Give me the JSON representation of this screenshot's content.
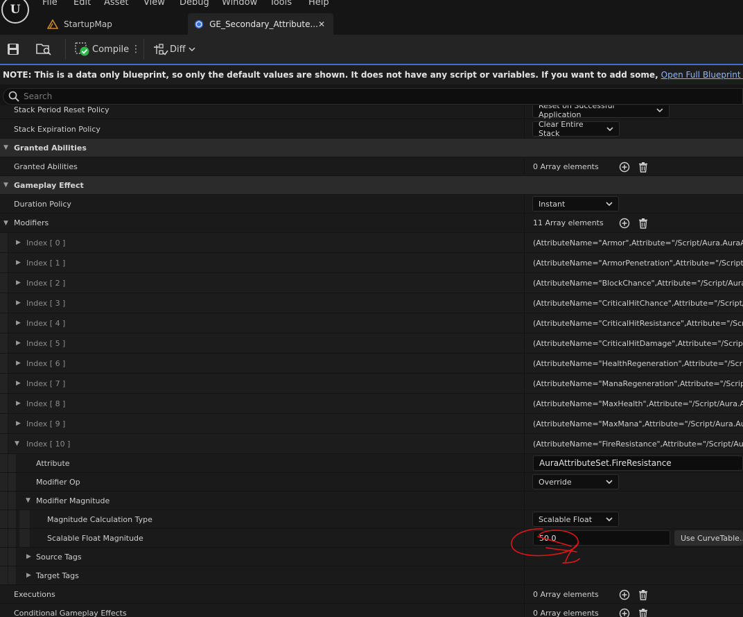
{
  "menu": [
    "File",
    "Edit",
    "Asset",
    "View",
    "Debug",
    "Window",
    "Tools",
    "Help"
  ],
  "tabs": [
    {
      "label": "StartupMap",
      "icon": "level-icon"
    },
    {
      "label": "GE_Secondary_Attribute...",
      "icon": "blueprint-icon"
    }
  ],
  "tab_close": "✕",
  "toolbar": {
    "compile_label": "Compile",
    "diff_label": "Diff"
  },
  "note": {
    "text": "NOTE: This is a data only blueprint, so only the default values are shown.  It does not have any script or variables.  If you want to add some,",
    "link": "Open Full Blueprint Editor"
  },
  "search": {
    "placeholder": "Search"
  },
  "details": {
    "stack_period_reset": {
      "label": "Stack Period Reset Policy",
      "value": "Reset on Successful Application"
    },
    "stack_expiration": {
      "label": "Stack Expiration Policy",
      "value": "Clear Entire Stack"
    },
    "cat_granted": "Granted Abilities",
    "granted_abilities": {
      "label": "Granted Abilities",
      "value": "0 Array elements"
    },
    "cat_gameplay_effect": "Gameplay Effect",
    "duration_policy": {
      "label": "Duration Policy",
      "value": "Instant"
    },
    "modifiers": {
      "label": "Modifiers",
      "value": "11 Array elements"
    },
    "indices": [
      {
        "label": "Index [ 0 ]",
        "value": "(AttributeName=\"Armor\",Attribute=\"/Script/Aura.AuraAttribu"
      },
      {
        "label": "Index [ 1 ]",
        "value": "(AttributeName=\"ArmorPenetration\",Attribute=\"/Script/Aura."
      },
      {
        "label": "Index [ 2 ]",
        "value": "(AttributeName=\"BlockChance\",Attribute=\"/Script/Aura.Aura"
      },
      {
        "label": "Index [ 3 ]",
        "value": "(AttributeName=\"CriticalHitChance\",Attribute=\"/Script/Aura."
      },
      {
        "label": "Index [ 4 ]",
        "value": "(AttributeName=\"CriticalHitResistance\",Attribute=\"/Script/A"
      },
      {
        "label": "Index [ 5 ]",
        "value": "(AttributeName=\"CriticalHitDamage\",Attribute=\"/Script/Aura"
      },
      {
        "label": "Index [ 6 ]",
        "value": "(AttributeName=\"HealthRegeneration\",Attribute=\"/Script/Aur"
      },
      {
        "label": "Index [ 7 ]",
        "value": "(AttributeName=\"ManaRegeneration\",Attribute=\"/Script/Aura"
      },
      {
        "label": "Index [ 8 ]",
        "value": "(AttributeName=\"MaxHealth\",Attribute=\"/Script/Aura.AuraAt"
      },
      {
        "label": "Index [ 9 ]",
        "value": "(AttributeName=\"MaxMana\",Attribute=\"/Script/Aura.AuraAttri"
      },
      {
        "label": "Index [ 10 ]",
        "value": "(AttributeName=\"FireResistance\",Attribute=\"/Script/Aura.Au"
      }
    ],
    "attribute": {
      "label": "Attribute",
      "value": "AuraAttributeSet.FireResistance"
    },
    "modifier_op": {
      "label": "Modifier Op",
      "value": "Override"
    },
    "modifier_magnitude": "Modifier Magnitude",
    "magnitude_calc": {
      "label": "Magnitude Calculation Type",
      "value": "Scalable Float"
    },
    "scalable_float": {
      "label": "Scalable Float Magnitude",
      "value": "50.0",
      "curve_button": "Use CurveTable..."
    },
    "source_tags": "Source Tags",
    "target_tags": "Target Tags",
    "executions": {
      "label": "Executions",
      "value": "0 Array elements"
    },
    "conditional": {
      "label": "Conditional Gameplay Effects",
      "value": "0 Array elements"
    }
  },
  "colors": {
    "accent_blue": "#3b6fd8",
    "link": "#8fb4ff",
    "annotation_red": "#e0141a",
    "compile_green": "#2fb84a"
  }
}
